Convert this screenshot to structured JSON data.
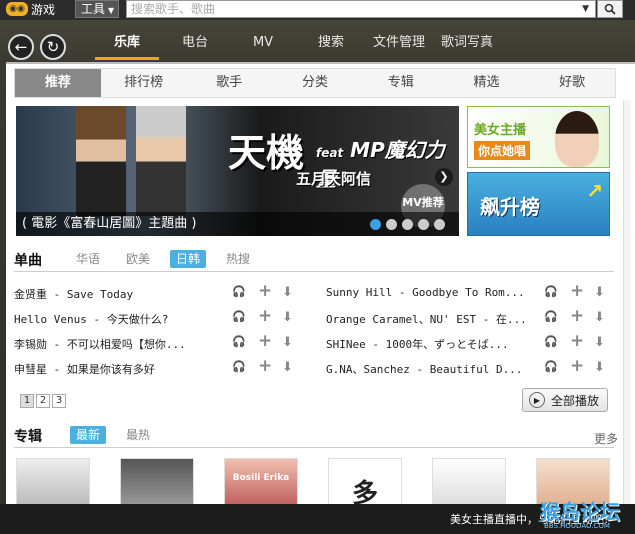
{
  "topbar": {
    "game_label": "游戏",
    "tools_label": "工具",
    "search_placeholder": "搜索歌手、歌曲"
  },
  "nav": {
    "tabs": [
      {
        "label": "乐库",
        "active": true
      },
      {
        "label": "电台",
        "active": false
      },
      {
        "label": "MV",
        "active": false
      },
      {
        "label": "搜索",
        "active": false
      },
      {
        "label": "文件管理",
        "active": false
      },
      {
        "label": "歌词写真",
        "active": false
      }
    ]
  },
  "subtabs": [
    {
      "label": "推荐",
      "active": true
    },
    {
      "label": "排行榜",
      "active": false
    },
    {
      "label": "歌手",
      "active": false
    },
    {
      "label": "分类",
      "active": false
    },
    {
      "label": "专辑",
      "active": false
    },
    {
      "label": "精选",
      "active": false
    },
    {
      "label": "好歌",
      "active": false
    }
  ],
  "banner": {
    "title_main": "天機",
    "title_feat": "feat",
    "title_sub": "MP魔幻力量",
    "title_line2": "五月天阿信",
    "mv_badge": "MV推荐",
    "caption": "( 電影《富春山居圖》主題曲 )",
    "dot_count": 5,
    "active_dot": 0
  },
  "ads": {
    "ad1_title": "美女主播",
    "ad1_button": "你点她唱",
    "ad2_title": "飙升榜"
  },
  "singles": {
    "heading": "单曲",
    "tabs": [
      {
        "label": "华语",
        "active": false
      },
      {
        "label": "欧美",
        "active": false
      },
      {
        "label": "日韩",
        "active": true
      },
      {
        "label": "热搜",
        "active": false
      }
    ],
    "left": [
      "金贤重 - Save Today",
      "Hello Venus - 今天做什么?",
      "李锡勋 - 不可以相爱吗【想你...",
      "申彗星 - 如果是你该有多好"
    ],
    "right": [
      "Sunny Hill - Goodbye To Rom...",
      "Orange Caramel、NU' EST - 在...",
      "SHINee - 1000年、ずっとそば...",
      "G.NA、Sanchez - Beautiful D..."
    ],
    "pages": [
      "1",
      "2",
      "3"
    ],
    "active_page": "1",
    "play_all_label": "全部播放"
  },
  "albums": {
    "heading": "专辑",
    "tabs": [
      {
        "label": "最新",
        "active": true
      },
      {
        "label": "最热",
        "active": false
      }
    ],
    "more_label": "更多",
    "covers": [
      {
        "label": ""
      },
      {
        "label": ""
      },
      {
        "label": "Bosili Erika"
      },
      {
        "label": "多"
      },
      {
        "label": ""
      },
      {
        "label": ""
      }
    ]
  },
  "footer": {
    "message": "美女主播直播中，与她们互动吧!",
    "watermark": "猴岛论坛",
    "watermark_url": "BBS.HOUDAO.COM"
  },
  "colors": {
    "accent": "#e8a81c",
    "tab_active": "#4ab0e0",
    "green": "#6aaa20"
  }
}
